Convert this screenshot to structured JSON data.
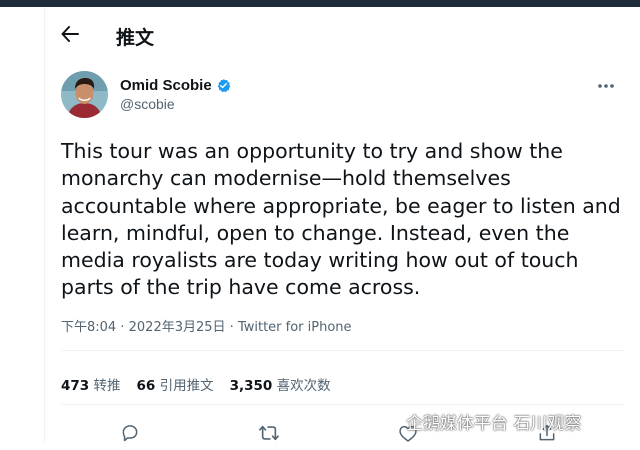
{
  "header": {
    "title": "推文"
  },
  "author": {
    "name": "Omid Scobie",
    "handle": "@scobie"
  },
  "tweet": {
    "text": "This tour was an opportunity to try and show the monarchy can modernise—hold themselves accountable where appropriate, be eager to listen and learn, mindful, open to change. Instead, even the media royalists are today writing how out of touch parts of the trip have come across.",
    "time": "下午8:04",
    "separator": "·",
    "date": "2022年3月25日",
    "source": "Twitter for iPhone"
  },
  "stats": {
    "retweets_count": "473",
    "retweets_label": "转推",
    "quotes_count": "66",
    "quotes_label": "引用推文",
    "likes_count": "3,350",
    "likes_label": "喜欢次数"
  },
  "watermark": {
    "text": "企鹅媒体平台 石川观察"
  },
  "colors": {
    "verified": "#1d9bf0",
    "text_primary": "#0f1419",
    "text_secondary": "#536471",
    "topbar": "#1e2b3a"
  },
  "icons": {
    "back": "arrow-left-icon",
    "verified": "verified-badge-icon",
    "more": "more-horizontal-icon",
    "reply": "reply-icon",
    "retweet": "retweet-icon",
    "like": "heart-icon",
    "share": "share-icon"
  }
}
